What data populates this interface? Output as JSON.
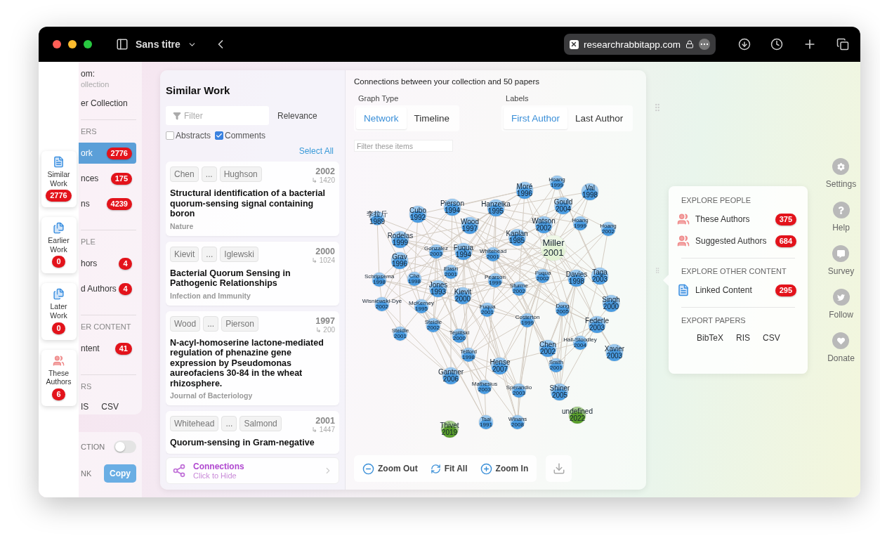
{
  "browser": {
    "tab_title": "Sans titre",
    "address": "researchrabbitapp.com"
  },
  "side_strip": [
    {
      "label": "Similar Work",
      "count": "2776",
      "kind": "similar"
    },
    {
      "label": "Earlier Work",
      "count": "0",
      "kind": "earlier"
    },
    {
      "label": "Later Work",
      "count": "0",
      "kind": "later"
    },
    {
      "label": "These Authors",
      "count": "6",
      "kind": "people"
    }
  ],
  "nav_panel": {
    "collection_label": "om:",
    "collection_sub": "ollection",
    "other_collection": "er Collection",
    "sections": [
      {
        "title": "ERS",
        "items": [
          {
            "label": "ork",
            "count": "2776",
            "selected": true
          },
          {
            "label": "nces",
            "count": "175",
            "selected": false
          },
          {
            "label": "ns",
            "count": "4239",
            "selected": false
          }
        ]
      },
      {
        "title": "PLE",
        "items": [
          {
            "label": "hors",
            "count": "4",
            "selected": false
          },
          {
            "label": "d Authors",
            "count": "4",
            "selected": false
          }
        ]
      },
      {
        "title": "ER CONTENT",
        "items": [
          {
            "label": "ntent",
            "count": "41",
            "selected": false
          }
        ]
      },
      {
        "title": "RS",
        "exports": [
          "IS",
          "CSV"
        ]
      }
    ]
  },
  "settings_card": {
    "toggle_label": "CTION",
    "toggle_on": false,
    "link_label": "NK",
    "copy_button": "Copy"
  },
  "similar_work": {
    "title": "Similar Work",
    "filter_placeholder": "Filter",
    "sort": "Relevance",
    "options": [
      {
        "label": "Abstracts",
        "checked": false
      },
      {
        "label": "Comments",
        "checked": true
      }
    ],
    "select_all": "Select All",
    "papers": [
      {
        "first_author": "Chen",
        "more": "...",
        "last_author": "Hughson",
        "year": "2002",
        "citations": "↳ 1420",
        "title": "Structural identification of a bacterial quorum-sensing signal containing boron",
        "journal": "Nature"
      },
      {
        "first_author": "Kievit",
        "more": "...",
        "last_author": "Iglewski",
        "year": "2000",
        "citations": "↳ 1024",
        "title": "Bacterial Quorum Sensing in Pathogenic Relationships",
        "journal": "Infection and Immunity"
      },
      {
        "first_author": "Wood",
        "more": "...",
        "last_author": "Pierson",
        "year": "1997",
        "citations": "↳ 200",
        "title": "N-acyl-homoserine lactone-mediated regulation of phenazine gene expression by Pseudomonas aureofaciens 30-84 in the wheat rhizosphere.",
        "journal": "Journal of Bacteriology"
      },
      {
        "first_author": "Whitehead",
        "more": "...",
        "last_author": "Salmond",
        "year": "2001",
        "citations": "↳ 1447",
        "title": "Quorum-sensing in Gram-negative"
      }
    ],
    "connections": {
      "title": "Connections",
      "hint": "Click to Hide"
    }
  },
  "graph": {
    "heading": "Connections between your collection and 50 papers",
    "graph_type": {
      "label": "Graph Type",
      "options": [
        {
          "label": "Network",
          "selected": true
        },
        {
          "label": "Timeline",
          "selected": false
        }
      ]
    },
    "labels": {
      "label": "Labels",
      "options": [
        {
          "label": "First Author",
          "selected": true
        },
        {
          "label": "Last Author",
          "selected": false
        }
      ]
    },
    "filter_placeholder": "Filter these items",
    "nodes": [
      {
        "name": "Moré",
        "year": "1996",
        "kind": "large",
        "color": "#4a9be0"
      },
      {
        "name": "Hoang",
        "year": "1999",
        "kind": "small",
        "color": "#4a9be0"
      },
      {
        "name": "Val",
        "year": "1998",
        "kind": "large",
        "color": "#4a9be0"
      },
      {
        "name": "李拉斤",
        "year": "1989",
        "kind": "small",
        "color": "#4a9be0"
      },
      {
        "name": "Cubo",
        "year": "1992",
        "kind": "large",
        "color": "#4a9be0"
      },
      {
        "name": "Pierson",
        "year": "1994",
        "kind": "large",
        "color": "#4a9be0"
      },
      {
        "name": "Hanzelka",
        "year": "1995",
        "kind": "large",
        "color": "#4a9be0"
      },
      {
        "name": "Gould",
        "year": "2004",
        "kind": "large",
        "color": "#4a9be0"
      },
      {
        "name": "Wood",
        "year": "1997",
        "kind": "large",
        "color": "#4a9be0"
      },
      {
        "name": "Watson",
        "year": "2002",
        "kind": "large",
        "color": "#4a9be0"
      },
      {
        "name": "Hoang",
        "year": "1999",
        "kind": "small",
        "color": "#4a9be0"
      },
      {
        "name": "Hoang",
        "year": "2002",
        "kind": "small",
        "color": "#4a9be0"
      },
      {
        "name": "Rodelas",
        "year": "1999",
        "kind": "large",
        "color": "#4a9be0"
      },
      {
        "name": "Grav",
        "year": "1996",
        "kind": "large",
        "color": "#4a9be0"
      },
      {
        "name": "Gonzalez",
        "year": "2003",
        "kind": "small",
        "color": "#4a9be0"
      },
      {
        "name": "Fuqua",
        "year": "1994",
        "kind": "large",
        "color": "#4a9be0"
      },
      {
        "name": "Whitehead",
        "year": "2001",
        "kind": "small",
        "color": "#4a9be0"
      },
      {
        "name": "Kaplan",
        "year": "1985",
        "kind": "large",
        "color": "#4a9be0"
      },
      {
        "name": "Miller",
        "year": "2001",
        "kind": "focus",
        "color": "#e2f2d4"
      },
      {
        "name": "Schripsema",
        "year": "1998",
        "kind": "small",
        "color": "#4a9be0"
      },
      {
        "name": "Cha",
        "year": "1998",
        "kind": "small",
        "color": "#4a9be0"
      },
      {
        "name": "Elasri",
        "year": "2001",
        "kind": "small",
        "color": "#4a9be0"
      },
      {
        "name": "Pearson",
        "year": "1999",
        "kind": "small",
        "color": "#4a9be0"
      },
      {
        "name": "Fuqua",
        "year": "2002",
        "kind": "small",
        "color": "#4a9be0"
      },
      {
        "name": "Davies",
        "year": "1998",
        "kind": "large",
        "color": "#4a9be0"
      },
      {
        "name": "Taga",
        "year": "2003",
        "kind": "large",
        "color": "#4a9be0"
      },
      {
        "name": "Jones",
        "year": "1993",
        "kind": "large",
        "color": "#4a9be0"
      },
      {
        "name": "Kievit",
        "year": "2000",
        "kind": "large",
        "color": "#4a9be0"
      },
      {
        "name": "Sturme",
        "year": "2002",
        "kind": "small",
        "color": "#4a9be0"
      },
      {
        "name": "Wisniewski-Dye",
        "year": "2002",
        "kind": "small",
        "color": "#4a9be0"
      },
      {
        "name": "McKerney",
        "year": "1995",
        "kind": "small",
        "color": "#4a9be0"
      },
      {
        "name": "Fuqua",
        "year": "2001",
        "kind": "small",
        "color": "#4a9be0"
      },
      {
        "name": "Dong",
        "year": "2005",
        "kind": "small",
        "color": "#4a9be0"
      },
      {
        "name": "Singh",
        "year": "2000",
        "kind": "large",
        "color": "#4a9be0"
      },
      {
        "name": "Steidle",
        "year": "2002",
        "kind": "small",
        "color": "#4a9be0"
      },
      {
        "name": "Costerton",
        "year": "1999",
        "kind": "small",
        "color": "#4a9be0"
      },
      {
        "name": "Federle",
        "year": "2003",
        "kind": "large",
        "color": "#4a9be0"
      },
      {
        "name": "Steidle",
        "year": "2001",
        "kind": "small",
        "color": "#4a9be0"
      },
      {
        "name": "Teplitski",
        "year": "2000",
        "kind": "small",
        "color": "#4a9be0"
      },
      {
        "name": "Telford",
        "year": "1998",
        "kind": "small",
        "color": "#4a9be0"
      },
      {
        "name": "Chen",
        "year": "2002",
        "kind": "large",
        "color": "#4a9be0"
      },
      {
        "name": "Hall-Stoodley",
        "year": "2004",
        "kind": "small",
        "color": "#4a9be0"
      },
      {
        "name": "Xavier",
        "year": "2003",
        "kind": "large",
        "color": "#4a9be0"
      },
      {
        "name": "Hense",
        "year": "2007",
        "kind": "large",
        "color": "#4a9be0"
      },
      {
        "name": "Smith",
        "year": "2001",
        "kind": "small",
        "color": "#4a9be0"
      },
      {
        "name": "Gantner",
        "year": "2006",
        "kind": "large",
        "color": "#4a9be0"
      },
      {
        "name": "Mathesius",
        "year": "2003",
        "kind": "small",
        "color": "#4a9be0"
      },
      {
        "name": "Sperandio",
        "year": "2003",
        "kind": "small",
        "color": "#4a9be0"
      },
      {
        "name": "Shiner",
        "year": "2005",
        "kind": "large",
        "color": "#4a9be0"
      },
      {
        "name": "Thivet",
        "year": "2019",
        "kind": "large",
        "color": "#5a9e2c"
      },
      {
        "name": "Tsai",
        "year": "1991",
        "kind": "small",
        "color": "#4a9be0"
      },
      {
        "name": "Winans",
        "year": "2008",
        "kind": "small",
        "color": "#4a9be0"
      },
      {
        "name": "undefined",
        "year": "2022",
        "kind": "large",
        "color": "#5a9e2c"
      }
    ],
    "toolbar": [
      {
        "label": "Zoom Out",
        "kind": "zoom-out"
      },
      {
        "label": "Fit All",
        "kind": "fit"
      },
      {
        "label": "Zoom In",
        "kind": "zoom-in"
      }
    ]
  },
  "explore_menu": {
    "sections": [
      {
        "title": "EXPLORE PEOPLE",
        "items": [
          {
            "label": "These Authors",
            "count": "375",
            "kind": "people"
          },
          {
            "label": "Suggested Authors",
            "count": "684",
            "kind": "people"
          }
        ]
      },
      {
        "title": "EXPLORE OTHER CONTENT",
        "items": [
          {
            "label": "Linked Content",
            "count": "295",
            "kind": "doc"
          }
        ]
      },
      {
        "title": "EXPORT PAPERS",
        "exports": [
          "BibTeX",
          "RIS",
          "CSV"
        ]
      }
    ]
  },
  "right_rail": [
    {
      "label": "Settings",
      "kind": "settings"
    },
    {
      "label": "Help",
      "kind": "help"
    },
    {
      "label": "Survey",
      "kind": "survey"
    },
    {
      "label": "Follow",
      "kind": "follow"
    },
    {
      "label": "Donate",
      "kind": "donate"
    }
  ]
}
